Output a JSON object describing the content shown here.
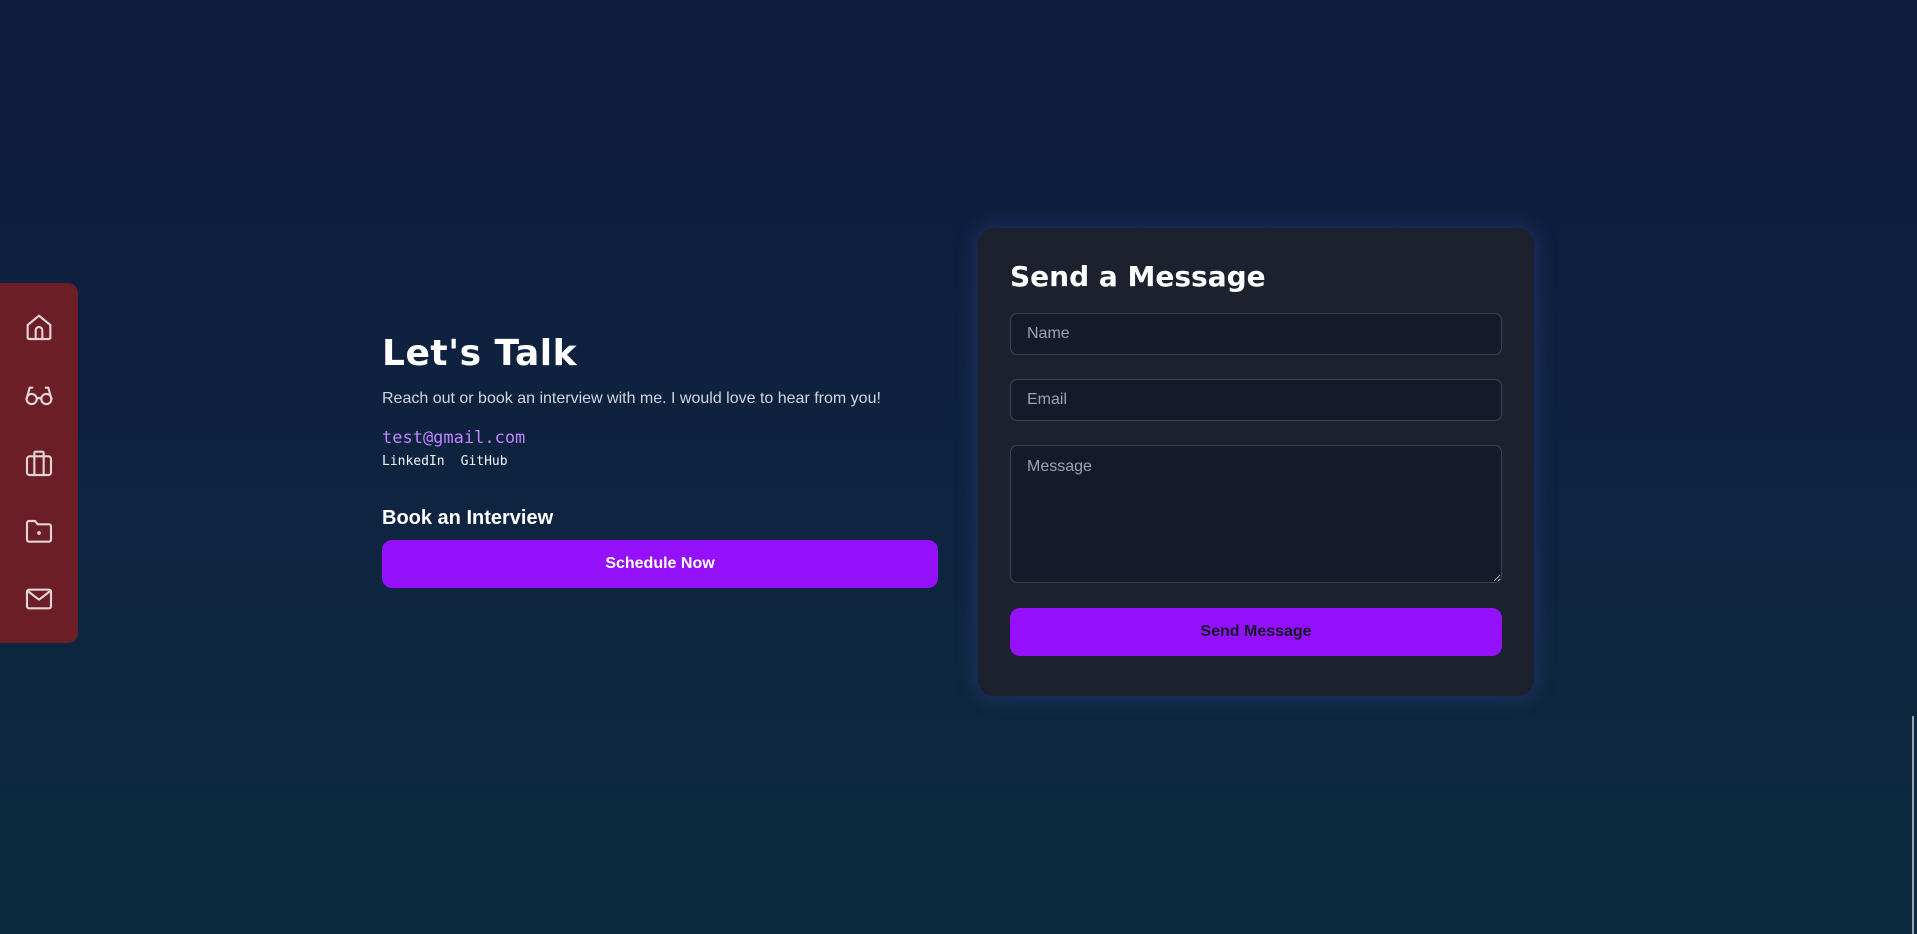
{
  "sidebar": {
    "items": [
      {
        "name": "home",
        "icon": "home-icon"
      },
      {
        "name": "about",
        "icon": "glasses-icon"
      },
      {
        "name": "experience",
        "icon": "briefcase-icon"
      },
      {
        "name": "projects",
        "icon": "folder-icon"
      },
      {
        "name": "contact",
        "icon": "mail-icon"
      }
    ]
  },
  "contact": {
    "title": "Let's Talk",
    "description": "Reach out or book an interview with me. I would love to hear from you!",
    "email": "test@gmail.com",
    "links": [
      "LinkedIn",
      "GitHub"
    ],
    "book_title": "Book an Interview",
    "schedule_label": "Schedule Now"
  },
  "form": {
    "title": "Send a Message",
    "name_placeholder": "Name",
    "email_placeholder": "Email",
    "message_placeholder": "Message",
    "submit_label": "Send Message"
  },
  "colors": {
    "accent": "#9611fb",
    "sidebar": "#6b1e26",
    "email": "#c084fc",
    "card": "#1d212e"
  }
}
